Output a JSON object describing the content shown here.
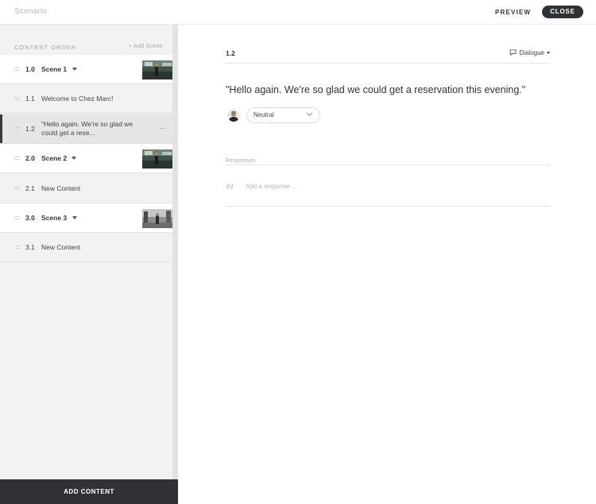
{
  "app": {
    "title": "Scenario",
    "preview_label": "PREVIEW",
    "close_label": "CLOSE"
  },
  "sidebar": {
    "header_label": "CONTENT ORDER",
    "add_scene_label": "+ Add Scene",
    "rows": [
      {
        "kind": "scene",
        "num": "1.0",
        "title": "Scene 1"
      },
      {
        "kind": "content",
        "num": "1.1",
        "title": "Welcome to Chez Marc!"
      },
      {
        "kind": "content",
        "num": "1.2",
        "title": "\"Hello again. We're so glad we could get a rese...",
        "selected": true
      },
      {
        "kind": "scene",
        "num": "2.0",
        "title": "Scene 2"
      },
      {
        "kind": "content",
        "num": "2.1",
        "title": "New Content"
      },
      {
        "kind": "scene",
        "num": "3.0",
        "title": "Scene 3"
      },
      {
        "kind": "content",
        "num": "3.1",
        "title": "New Content"
      }
    ],
    "more_label": "...",
    "add_content_label": "ADD CONTENT"
  },
  "main": {
    "content_id": "1.2",
    "content_type": "Dialogue",
    "dialogue_text": "\"Hello again. We're so glad we could get a reservation this evening.\"",
    "emotion_value": "Neutral",
    "responses_label": "Responses",
    "responses": [
      {
        "index": "01",
        "placeholder": "Add a response ..."
      }
    ]
  },
  "colors": {
    "dark_button": "#2f3234",
    "sidebar_bg": "#f2f2f2",
    "selected_row_bg": "#e6e6e6"
  }
}
